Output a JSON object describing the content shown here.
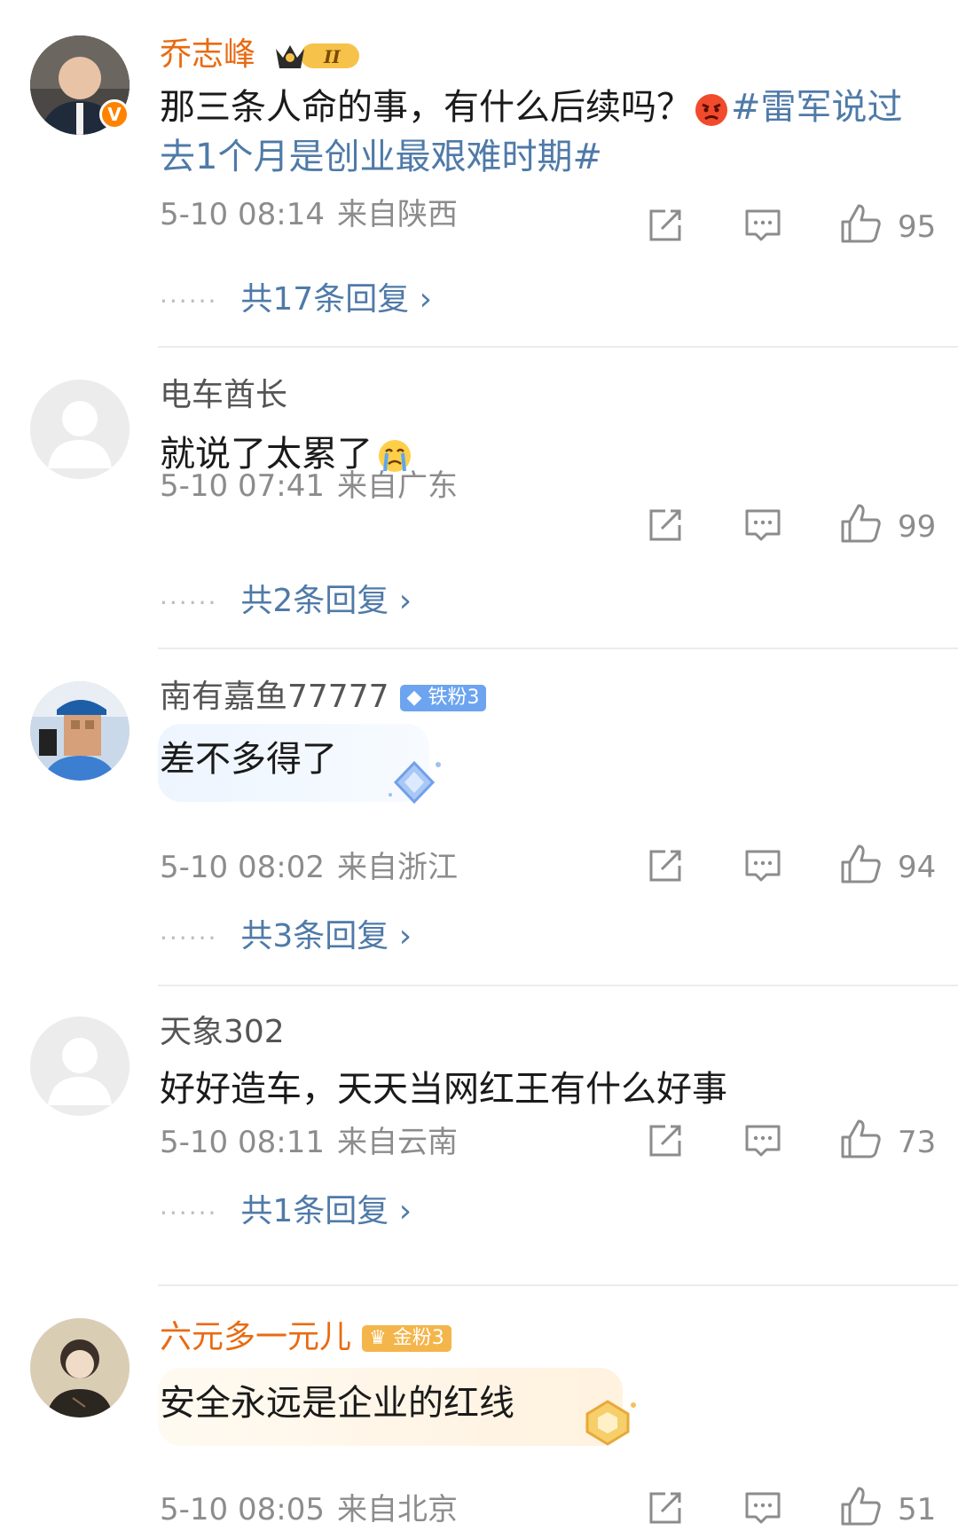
{
  "comments": [
    {
      "username": "乔志峰",
      "verified_badge": "v",
      "vip_badge_level": "II",
      "content": "那三条人命的事，有什么后续吗？",
      "emoji": "angry-face",
      "topic": "#雷军说过去1个月是创业最艰难时期#",
      "date": "5-10 08:14",
      "location": "来自陕西",
      "likes": "95",
      "replies": "共17条回复 ›"
    },
    {
      "username": "电车酋长",
      "content": "就说了太累了",
      "emoji": "crying-face",
      "date": "5-10 07:41",
      "location": "来自广东",
      "likes": "99",
      "replies": "共2条回复 ›"
    },
    {
      "username": "南有嘉鱼77777",
      "fan_badge": "铁粉3",
      "content": "差不多得了",
      "date": "5-10 08:02",
      "location": "来自浙江",
      "likes": "94",
      "replies": "共3条回复 ›"
    },
    {
      "username": "天象302",
      "content": "好好造车，天天当网红王有什么好事",
      "date": "5-10 08:11",
      "location": "来自云南",
      "likes": "73",
      "replies": "共1条回复 ›"
    },
    {
      "username": "六元多一元儿",
      "fan_badge": "金粉3",
      "content": "安全永远是企业的红线",
      "date": "5-10 08:05",
      "location": "来自北京",
      "likes": "51"
    }
  ],
  "colors": {
    "username_orange": "#e86b12",
    "link_blue": "#4f7aa8",
    "meta_gray": "#8c8c8c",
    "verified_orange": "#ff8200"
  },
  "icons": [
    "share-icon",
    "comment-icon",
    "like-icon",
    "chevron-right-icon"
  ]
}
